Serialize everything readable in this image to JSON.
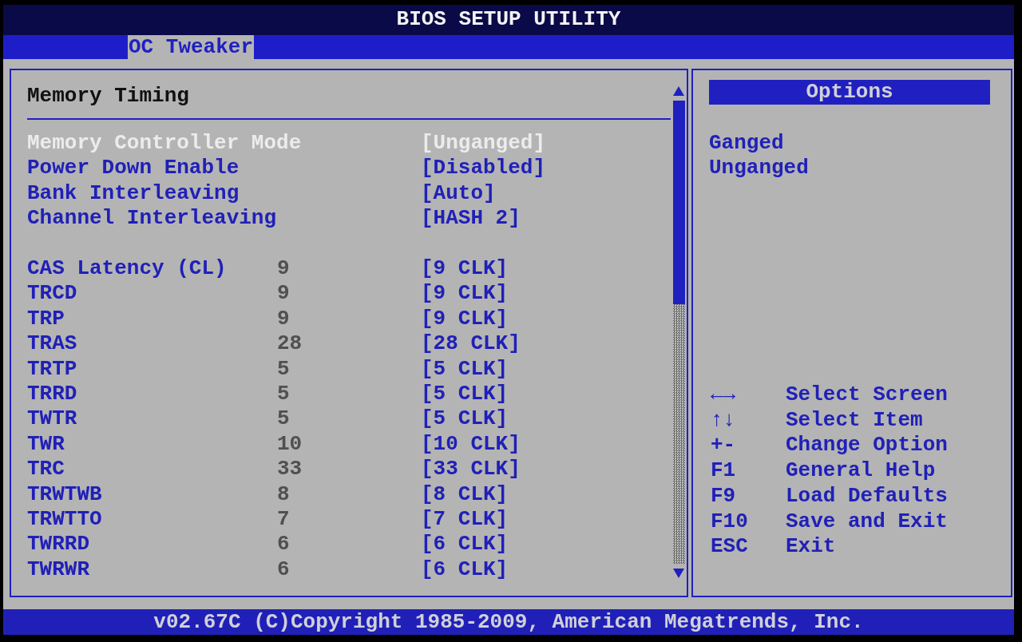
{
  "title": "BIOS SETUP UTILITY",
  "tabs": [
    {
      "label": "OC Tweaker",
      "selected": true
    }
  ],
  "panel": {
    "heading": "Memory Timing",
    "groups": [
      {
        "items": [
          {
            "label": "Memory Controller Mode",
            "value": "[Unganged]",
            "selected": true
          },
          {
            "label": "Power Down Enable",
            "value": "[Disabled]",
            "selected": false
          },
          {
            "label": "Bank Interleaving",
            "value": "[Auto]",
            "selected": false
          },
          {
            "label": "Channel Interleaving",
            "value": "[HASH 2]",
            "selected": false
          }
        ]
      },
      {
        "items": [
          {
            "label": "CAS Latency (CL)",
            "current": "9",
            "value": "[9 CLK]",
            "selected": false
          },
          {
            "label": "TRCD",
            "current": "9",
            "value": "[9 CLK]",
            "selected": false
          },
          {
            "label": "TRP",
            "current": "9",
            "value": "[9 CLK]",
            "selected": false
          },
          {
            "label": "TRAS",
            "current": "28",
            "value": "[28 CLK]",
            "selected": false
          },
          {
            "label": "TRTP",
            "current": "5",
            "value": "[5 CLK]",
            "selected": false
          },
          {
            "label": "TRRD",
            "current": "5",
            "value": "[5 CLK]",
            "selected": false
          },
          {
            "label": "TWTR",
            "current": "5",
            "value": "[5 CLK]",
            "selected": false
          },
          {
            "label": "TWR",
            "current": "10",
            "value": "[10 CLK]",
            "selected": false
          },
          {
            "label": "TRC",
            "current": "33",
            "value": "[33 CLK]",
            "selected": false
          },
          {
            "label": "TRWTWB",
            "current": "8",
            "value": "[8 CLK]",
            "selected": false
          },
          {
            "label": "TRWTTO",
            "current": "7",
            "value": "[7 CLK]",
            "selected": false
          },
          {
            "label": "TWRRD",
            "current": "6",
            "value": "[6 CLK]",
            "selected": false
          },
          {
            "label": "TWRWR",
            "current": "6",
            "value": "[6 CLK]",
            "selected": false
          }
        ]
      }
    ]
  },
  "options": {
    "title": "Options",
    "items": [
      "Ganged",
      "Unganged"
    ]
  },
  "help": [
    {
      "key": "←→",
      "action": "Select Screen"
    },
    {
      "key": "↑↓",
      "action": "Select Item"
    },
    {
      "key": "+-",
      "action": "Change Option"
    },
    {
      "key": "F1",
      "action": "General Help"
    },
    {
      "key": "F9",
      "action": "Load Defaults"
    },
    {
      "key": "F10",
      "action": "Save and Exit"
    },
    {
      "key": "ESC",
      "action": "Exit"
    }
  ],
  "status_bar": "v02.67C (C)Copyright 1985-2009, American Megatrends, Inc."
}
